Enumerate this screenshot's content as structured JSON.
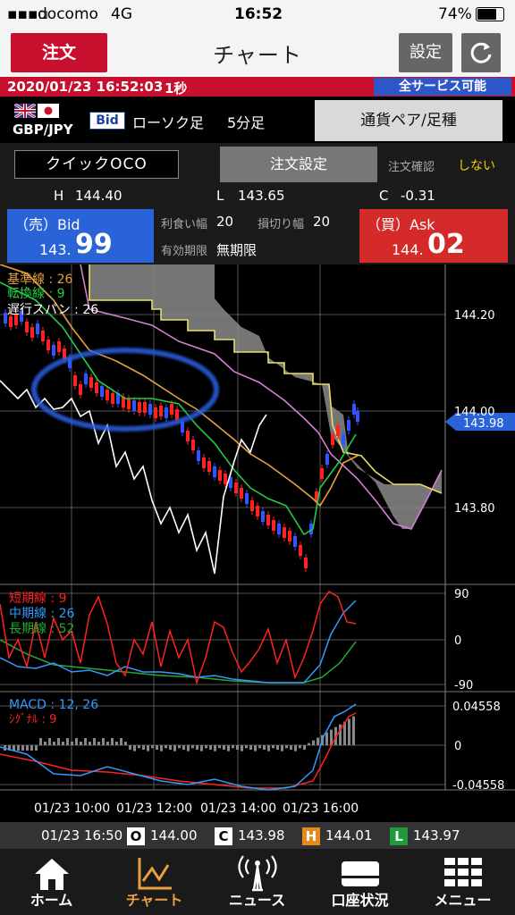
{
  "status": {
    "carrier": "docomo",
    "network": "4G",
    "time": "16:52",
    "battery": "74%"
  },
  "header": {
    "order_label": "注文",
    "title": "チャート",
    "settings_label": "設定"
  },
  "infobar": {
    "datetime": "2020/01/23 16:52:03",
    "interval": "1秒",
    "service": "全サービス可能"
  },
  "pair": {
    "pair_name": "GBP/JPY",
    "side": "Bid",
    "candle_type": "ローソク足",
    "timeframe": "5分足",
    "pair_button": "通貨ペア/足種"
  },
  "order": {
    "mode": "クイックOCO",
    "settings_button": "注文設定",
    "confirm_label": "注文確認",
    "confirm_value": "しない"
  },
  "hlc": {
    "h_label": "H",
    "h": "144.40",
    "l_label": "L",
    "l": "143.65",
    "c_label": "C",
    "c": "-0.31"
  },
  "bid": {
    "label": "（売）Bid",
    "price_prefix": "143.",
    "price_main": "99"
  },
  "ask": {
    "label": "（買）Ask",
    "price_prefix": "144.",
    "price_main": "02"
  },
  "params": {
    "tp_label": "利食い幅",
    "tp": "20",
    "sl_label": "損切り幅",
    "sl": "20",
    "exp_label": "有効期限",
    "exp": "無期限"
  },
  "chart_data": [
    {
      "type": "line",
      "legend": [
        "基準線 : 26",
        "転換線 : 9",
        "遅行スパン : 26"
      ],
      "y_ticks": [
        "144.20",
        "144.00",
        "143.80"
      ],
      "current_price": "143.98",
      "colors": {
        "kijun": "#e8a040",
        "tenkan": "#22cc44",
        "chikou": "#ffffff",
        "span_a": "#e8e060",
        "span_b": "#d080d0",
        "cloud": "#8a8a8a",
        "up": "#3355ff",
        "down": "#ff2222"
      }
    },
    {
      "type": "line",
      "legend": [
        "短期線 : 9",
        "中期線 : 26",
        "長期線 : 52"
      ],
      "y_ticks": [
        "90",
        "0",
        "-90"
      ],
      "colors": {
        "short": "#ff2222",
        "mid": "#3399ff",
        "long": "#22aa33"
      }
    },
    {
      "type": "bar",
      "legend": [
        "MACD : 12, 26",
        "ｼｸﾞﾅﾙ : 9"
      ],
      "y_ticks": [
        "0.04558",
        "0",
        "-0.04558"
      ],
      "colors": {
        "macd": "#3399ff",
        "signal": "#ff2222",
        "hist": "#888888"
      }
    }
  ],
  "x_ticks": [
    "01/23 10:00",
    "01/23 12:00",
    "01/23 14:00",
    "01/23 16:00"
  ],
  "ohlc": {
    "time": "01/23 16:50",
    "o_label": "O",
    "o": "144.00",
    "c_label": "C",
    "c": "143.98",
    "h_label": "H",
    "h": "144.01",
    "l_label": "L",
    "l": "143.97"
  },
  "tabs": [
    {
      "label": "ホーム",
      "icon": "home-icon"
    },
    {
      "label": "チャート",
      "icon": "chart-icon"
    },
    {
      "label": "ニュース",
      "icon": "news-icon"
    },
    {
      "label": "口座状況",
      "icon": "account-icon"
    },
    {
      "label": "メニュー",
      "icon": "menu-icon"
    }
  ]
}
